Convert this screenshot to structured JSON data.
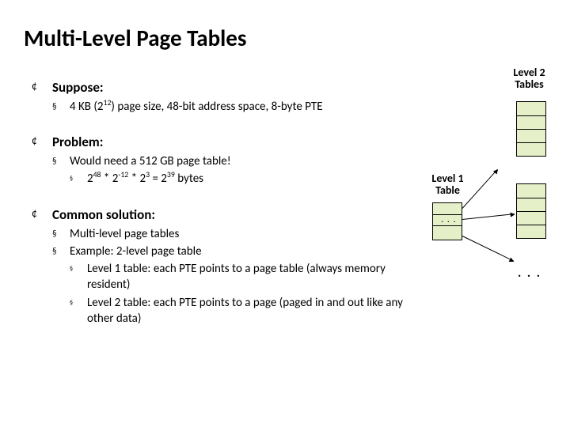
{
  "title": "Multi-Level Page Tables",
  "sections": {
    "suppose": {
      "heading": "Suppose:",
      "bullet1_pre": "4 KB (2",
      "bullet1_sup": "12",
      "bullet1_post": ") page size, 48-bit address space, 8-byte PTE"
    },
    "problem": {
      "heading": "Problem:",
      "bullet1": "Would need a 512 GB page table!",
      "calc_a": "2",
      "calc_a_sup": "48",
      "calc_b": " * 2",
      "calc_b_sup": "-12",
      "calc_c": " * 2",
      "calc_c_sup": "3",
      "calc_d": " = 2",
      "calc_d_sup": "39",
      "calc_e": " bytes"
    },
    "solution": {
      "heading": "Common solution:",
      "bullet1": "Multi-level page tables",
      "bullet2": "Example: 2-level page table",
      "sub1": "Level 1 table: each PTE points to a page table (always memory resident)",
      "sub2": "Level 2 table: each PTE points to a page (paged in and out like any other data)"
    }
  },
  "diagram": {
    "label_l2_a": "Level 2",
    "label_l2_b": "Tables",
    "label_l1_a": "Level 1",
    "label_l1_b": "Table",
    "dots": ". . ."
  }
}
